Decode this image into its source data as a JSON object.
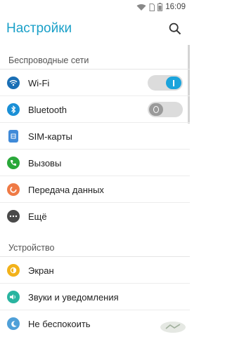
{
  "status_bar": {
    "time": "16:09",
    "icons": [
      "wifi-icon",
      "sim-icon",
      "battery-icon"
    ]
  },
  "app_bar": {
    "title": "Настройки",
    "search_icon": "search-icon"
  },
  "sections": [
    {
      "header": "Беспроводные сети",
      "items": [
        {
          "label": "Wi-Fi",
          "icon": "wifi-icon",
          "color": "#1a6fb5",
          "toggle": "on"
        },
        {
          "label": "Bluetooth",
          "icon": "bluetooth-icon",
          "color": "#1a8fd6",
          "toggle": "off"
        },
        {
          "label": "SIM-карты",
          "icon": "sim-card-icon",
          "color": "#3f8ad8"
        },
        {
          "label": "Вызовы",
          "icon": "phone-icon",
          "color": "#2aa83a"
        },
        {
          "label": "Передача данных",
          "icon": "data-usage-icon",
          "color": "#ef7a45"
        },
        {
          "label": "Ещё",
          "icon": "more-icon",
          "color": "#4a4a4a"
        }
      ]
    },
    {
      "header": "Устройство",
      "items": [
        {
          "label": "Экран",
          "icon": "display-icon",
          "color": "#f2b21b"
        },
        {
          "label": "Звуки и уведомления",
          "icon": "sound-icon",
          "color": "#29b4a0"
        },
        {
          "label": "Не беспокоить",
          "icon": "moon-icon",
          "color": "#4fa0d8"
        }
      ]
    }
  ]
}
